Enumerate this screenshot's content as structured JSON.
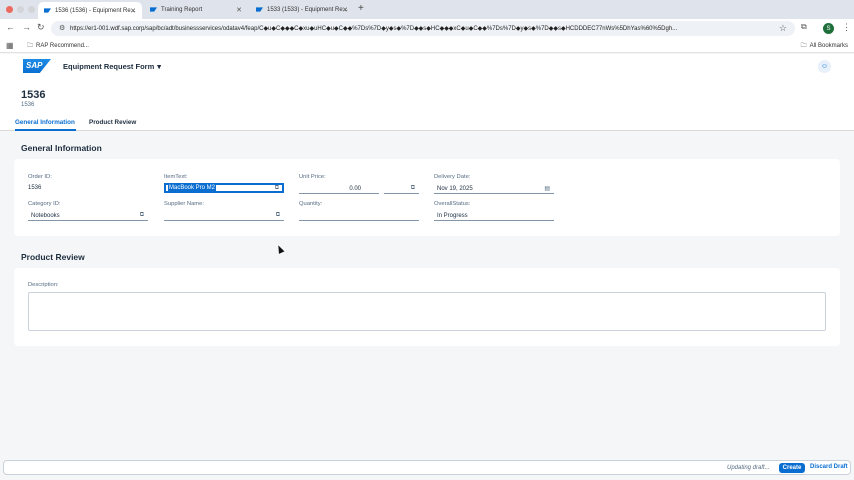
{
  "browser": {
    "tabs": [
      {
        "label": "1536 (1536) - Equipment Re..."
      },
      {
        "label": "Training Report"
      },
      {
        "label": "1533 (1533) - Equipment Re..."
      }
    ],
    "url": "https://er1-001.wdf.sap.corp/sap/bc/adt/businessservices/odatav4/feap/C◆u◆C◆◆◆C◆xu◆uHC◆u◆C◆◆%7Ds%7D◆y◆s◆%7D◆◆s◆HC◆◆◆xC◆u◆C◆◆%7Ds%7D◆y◆s◆%7D◆◆s◆HCDDDEC77nWs%5DhYas%60%5Dgh...",
    "profile_initial": "S",
    "bookmark_folder": "RAP Recommend...",
    "all_bookmarks": "All Bookmarks"
  },
  "shell": {
    "logo": "SAP",
    "app_title": "Equipment Request Form",
    "chevron": "▾",
    "user_icon": "☺"
  },
  "object_header": {
    "title": "1536",
    "subtitle": "1536",
    "tabs": [
      "General Information",
      "Product Review"
    ]
  },
  "general": {
    "title": "General Information",
    "order_id_label": "Order ID:",
    "order_id_value": "1536",
    "item_text_label": "ItemText:",
    "item_text_value": "MacBook Pro M2",
    "unit_price_label": "Unit Price:",
    "unit_price_value": "0.00",
    "delivery_date_label": "Delivery Date:",
    "delivery_date_value": "Nov 19, 2025",
    "category_id_label": "Category ID:",
    "category_id_value": "Notebooks",
    "supplier_name_label": "Supplier Name:",
    "supplier_name_value": "",
    "quantity_label": "Quantity:",
    "quantity_value": "",
    "overall_status_label": "OverallStatus:",
    "overall_status_value": "In Progress"
  },
  "review": {
    "title": "Product Review",
    "description_label": "Description:",
    "description_value": ""
  },
  "footer": {
    "status": "Updating draft...",
    "create_label": "Create",
    "discard_label": "Discard Draft"
  },
  "colors": {
    "accent": "#0a6ed1",
    "text": "#1d2d3e",
    "label": "#556b82"
  }
}
